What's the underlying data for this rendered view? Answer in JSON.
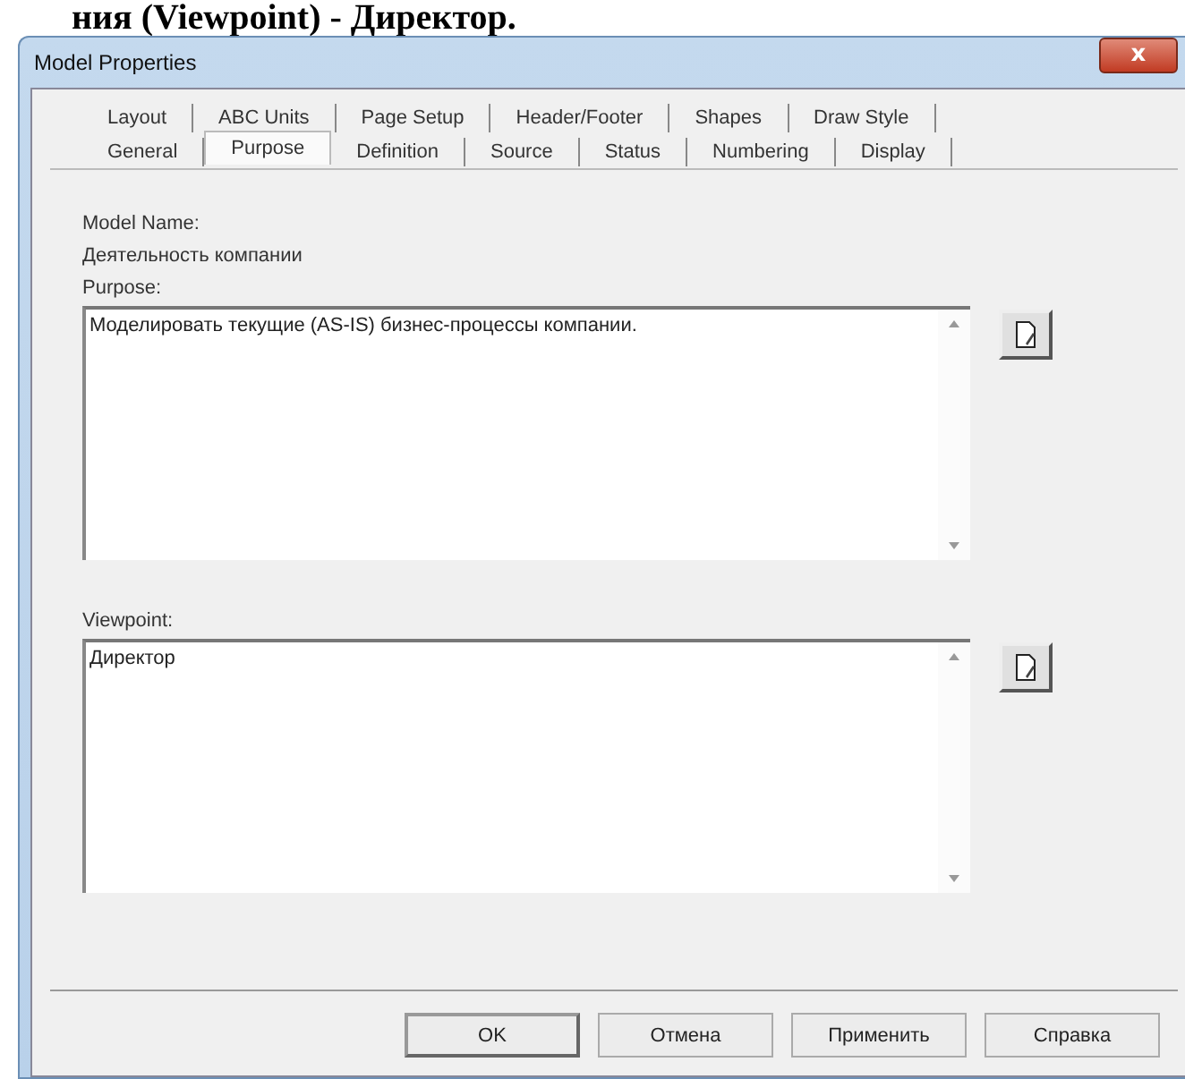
{
  "document_caption": "ния (Viewpoint) - Директор.",
  "window": {
    "title": "Model Properties",
    "close": "x"
  },
  "tab_rows": [
    {
      "tabs": [
        {
          "label": "Layout",
          "selected": false
        },
        {
          "label": "ABC Units",
          "selected": false
        },
        {
          "label": "Page Setup",
          "selected": false
        },
        {
          "label": "Header/Footer",
          "selected": false
        },
        {
          "label": "Shapes",
          "selected": false
        },
        {
          "label": "Draw Style",
          "selected": false
        }
      ]
    },
    {
      "tabs": [
        {
          "label": "General",
          "selected": false
        },
        {
          "label": "Purpose",
          "selected": true
        },
        {
          "label": "Definition",
          "selected": false
        },
        {
          "label": "Source",
          "selected": false
        },
        {
          "label": "Status",
          "selected": false
        },
        {
          "label": "Numbering",
          "selected": false
        },
        {
          "label": "Display",
          "selected": false
        }
      ]
    }
  ],
  "model_name": {
    "label": "Model Name:",
    "value": "Деятельность компании"
  },
  "fields": [
    {
      "label": "Purpose:",
      "value": "Моделировать текущие (AS-IS) бизнес-процессы компании."
    },
    {
      "label": "Viewpoint:",
      "value": "Директор"
    }
  ],
  "buttons": [
    {
      "label": "OK",
      "default": true
    },
    {
      "label": "Отмена",
      "default": false
    },
    {
      "label": "Применить",
      "default": false
    },
    {
      "label": "Справка",
      "default": false
    }
  ]
}
